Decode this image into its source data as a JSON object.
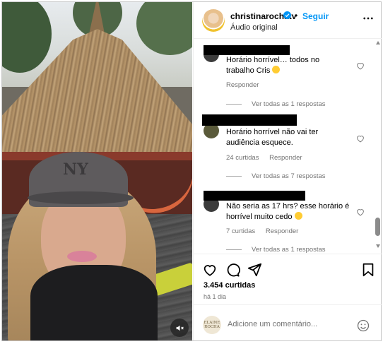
{
  "post": {
    "username": "christinarochatv",
    "separator": "•",
    "follow_label": "Seguir",
    "audio_label": "Áudio original"
  },
  "comments": [
    {
      "text": "Horário horrível… todos no trabalho Cris",
      "has_emoji": true,
      "likes": "",
      "reply_label": "Responder",
      "see_replies": "Ver todas as 1 respostas"
    },
    {
      "text": "Horário horrível não vai ter audiência esquece.",
      "has_emoji": false,
      "likes": "24 curtidas",
      "reply_label": "Responder",
      "see_replies": "Ver todas as 7 respostas"
    },
    {
      "text": "Não seria as 17 hrs? esse horário é horrível muito cedo",
      "has_emoji": true,
      "likes": "7 curtidas",
      "reply_label": "Responder",
      "see_replies": "Ver todas as 1 respostas"
    }
  ],
  "actions": {
    "likes_count": "3.454 curtidas",
    "time_ago": "há 1 dia"
  },
  "composer": {
    "placeholder": "Adicione um comentário...",
    "brand_avatar_text": "ELAINE ROCHA"
  },
  "icons": [
    "mute-icon",
    "verified-icon",
    "more-options-icon",
    "heart-icon",
    "comment-icon",
    "share-icon",
    "save-icon",
    "emoji-icon"
  ],
  "colors": {
    "accent": "#0095f6",
    "muted_text": "#737373",
    "divider": "#efefef"
  }
}
